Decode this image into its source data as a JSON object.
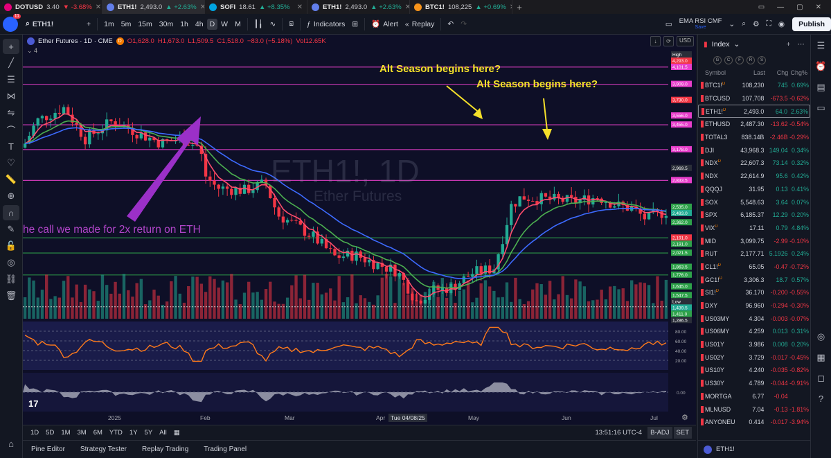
{
  "browser_tabs": [
    {
      "name": "DOTUSD",
      "price": "3.40",
      "change": "▼ -3.68%",
      "dir": "neg",
      "color": "#e6007a"
    },
    {
      "name": "ETH1!",
      "price": "2,493.0",
      "change": "▲ +2.63%",
      "dir": "pos",
      "color": "#627eea",
      "active": true
    },
    {
      "name": "SOFI",
      "price": "18.61",
      "change": "▲ +8.35%",
      "dir": "pos",
      "color": "#00a3e0"
    },
    {
      "name": "ETH1!",
      "price": "2,493.0",
      "change": "▲ +2.63%",
      "dir": "pos",
      "color": "#627eea"
    },
    {
      "name": "BTC1!",
      "price": "108,225",
      "change": "▲ +0.69%",
      "dir": "pos",
      "color": "#f7931a"
    }
  ],
  "toolbar": {
    "avatar_badge": "11",
    "symbol": "ETH1!",
    "timeframes": [
      "1m",
      "5m",
      "15m",
      "30m",
      "1h",
      "4h",
      "D",
      "W",
      "M"
    ],
    "active_timeframe": "D",
    "indicators_label": "Indicators",
    "alert_label": "Alert",
    "replay_label": "Replay",
    "layout_name": "EMA RSI CMF",
    "layout_sub": "Save",
    "publish_label": "Publish"
  },
  "chart": {
    "title": "Ether Futures · 1D · CME",
    "ohlc": {
      "o": "O1,628.0",
      "h": "H1,673.0",
      "l": "L1,509.5",
      "c": "C1,518.0",
      "chg": "−83.0 (−5.18%)",
      "vol": "Vol12.65K"
    },
    "sub_count": "4",
    "currency": "USD",
    "watermark_symbol": "ETH1!, 1D",
    "watermark_name": "Ether Futures",
    "annotation_1": "Alt Season begins here?",
    "annotation_2": "Alt Season begins here?",
    "annotation_3": "he call we made for 2x return on ETH",
    "price_labels": [
      "High",
      "4,293.0",
      "4,101.5",
      "3,909.0",
      "3,730.0",
      "3,556.0",
      "3,455.0",
      "3,178.0",
      "2,969.5",
      "2,833.5",
      "2,535.0",
      "2,493.0",
      "2,362.0",
      "2,191.0",
      "2,191.0",
      "2,021.5",
      "1,863.5",
      "1,776.0",
      "1,645.0",
      "1,547.5",
      "Low",
      "1,439.5",
      "1,411.0",
      "1,286.5"
    ],
    "rsi_labels": [
      "80.00",
      "60.00",
      "40.00",
      "20.00"
    ],
    "cmf_label": "0.00",
    "x_labels": [
      "2025",
      "Feb",
      "Mar",
      "Apr",
      "May",
      "Jun",
      "Jul"
    ],
    "x_highlight": "Tue 04/08/25",
    "tv_logo": "17"
  },
  "chart_data": {
    "type": "candlestick",
    "title": "Ether Futures · 1D · CME",
    "x_range": [
      "2024-12",
      "2025-07"
    ],
    "y_range": [
      1286.5,
      4293.0
    ],
    "horizontal_levels": [
      4101.5,
      3909.0,
      3455.0,
      3178.0,
      2833.5,
      2191.0,
      2021.5,
      1776.0
    ],
    "overlays": [
      "EMA fast (red)",
      "EMA mid (green)",
      "EMA slow (blue)"
    ],
    "panes": [
      "volume",
      "RSI",
      "CMF"
    ]
  },
  "range_bar": {
    "ranges": [
      "1D",
      "5D",
      "1M",
      "3M",
      "6M",
      "YTD",
      "1Y",
      "5Y",
      "All"
    ],
    "clock": "13:51:16 UTC-4",
    "badj": "B-ADJ",
    "set": "SET"
  },
  "panels": [
    "Pine Editor",
    "Strategy Tester",
    "Replay Trading",
    "Trading Panel"
  ],
  "watchlist": {
    "title": "Index",
    "filters": [
      "G",
      "C",
      "F",
      "R",
      "S"
    ],
    "cols": [
      "Symbol",
      "Last",
      "Chg",
      "Chg%"
    ],
    "rows": [
      {
        "sym": "BTC1!",
        "d": true,
        "last": "108,230",
        "chg": "745",
        "pct": "0.69%",
        "dir": "pos",
        "flag": true
      },
      {
        "sym": "BTCUSD",
        "last": "107,708",
        "chg": "-673.5",
        "pct": "-0.62%",
        "dir": "neg",
        "flag": true
      },
      {
        "sym": "ETH1!",
        "d": true,
        "last": "2,493.0",
        "chg": "64.0",
        "pct": "2.63%",
        "dir": "pos",
        "flag": true,
        "sel": true
      },
      {
        "sym": "ETHUSD",
        "last": "2,487.30",
        "chg": "-13.62",
        "pct": "-0.54%",
        "dir": "neg",
        "flag": true
      },
      {
        "sym": "TOTAL3",
        "last": "838.14B",
        "chg": "-2.46B",
        "pct": "-0.29%",
        "dir": "neg",
        "flag": true
      },
      {
        "sym": "DJI",
        "last": "43,968.3",
        "chg": "149.04",
        "pct": "0.34%",
        "dir": "pos",
        "flag": true
      },
      {
        "sym": "NDX",
        "d": true,
        "last": "22,607.3",
        "chg": "73.14",
        "pct": "0.32%",
        "dir": "pos",
        "flag": true
      },
      {
        "sym": "NDX",
        "last": "22,614.9",
        "chg": "95.6",
        "pct": "0.42%",
        "dir": "pos",
        "flag": true
      },
      {
        "sym": "QQQJ",
        "last": "31.95",
        "chg": "0.13",
        "pct": "0.41%",
        "dir": "pos",
        "flag": true
      },
      {
        "sym": "SOX",
        "last": "5,548.63",
        "chg": "3.64",
        "pct": "0.07%",
        "dir": "pos",
        "flag": true
      },
      {
        "sym": "SPX",
        "last": "6,185.37",
        "chg": "12.29",
        "pct": "0.20%",
        "dir": "pos",
        "flag": true
      },
      {
        "sym": "VIX",
        "d": true,
        "last": "17.11",
        "chg": "0.79",
        "pct": "4.84%",
        "dir": "pos",
        "flag": true
      },
      {
        "sym": "MID",
        "last": "3,099.75",
        "chg": "-2.99",
        "pct": "-0.10%",
        "dir": "neg",
        "flag": true
      },
      {
        "sym": "RUT",
        "last": "2,177.71",
        "chg": "5.1926",
        "pct": "0.24%",
        "dir": "pos",
        "flag": true
      },
      {
        "sym": "CL1!",
        "d": true,
        "last": "65.05",
        "chg": "-0.47",
        "pct": "-0.72%",
        "dir": "neg",
        "flag": true
      },
      {
        "sym": "GC1!",
        "d": true,
        "last": "3,306.3",
        "chg": "18.7",
        "pct": "0.57%",
        "dir": "pos",
        "flag": true
      },
      {
        "sym": "SI1!",
        "d": true,
        "last": "36.170",
        "chg": "-0.200",
        "pct": "-0.55%",
        "dir": "neg",
        "flag": true
      },
      {
        "sym": "DXY",
        "last": "96.960",
        "chg": "-0.294",
        "pct": "-0.30%",
        "dir": "neg",
        "flag": true
      },
      {
        "sym": "US03MY",
        "last": "4.304",
        "chg": "-0.003",
        "pct": "-0.07%",
        "dir": "neg",
        "flag": true
      },
      {
        "sym": "US06MY",
        "last": "4.259",
        "chg": "0.013",
        "pct": "0.31%",
        "dir": "pos",
        "flag": true
      },
      {
        "sym": "US01Y",
        "last": "3.986",
        "chg": "0.008",
        "pct": "0.20%",
        "dir": "pos",
        "flag": true
      },
      {
        "sym": "US02Y",
        "last": "3.729",
        "chg": "-0.017",
        "pct": "-0.45%",
        "dir": "neg",
        "flag": true
      },
      {
        "sym": "US10Y",
        "last": "4.240",
        "chg": "-0.035",
        "pct": "-0.82%",
        "dir": "neg",
        "flag": true
      },
      {
        "sym": "US30Y",
        "last": "4.789",
        "chg": "-0.044",
        "pct": "-0.91%",
        "dir": "neg",
        "flag": true
      },
      {
        "sym": "MORTGA",
        "last": "6.77",
        "chg": "-0.04",
        "pct": "",
        "dir": "neg",
        "flag": true
      },
      {
        "sym": "MLNUSD",
        "last": "7.04",
        "chg": "-0.13",
        "pct": "-1.81%",
        "dir": "neg",
        "flag": true
      },
      {
        "sym": "ANYONEU",
        "last": "0.414",
        "chg": "-0.017",
        "pct": "-3.94%",
        "dir": "neg",
        "flag": true
      }
    ],
    "footer_symbol": "ETH1!"
  },
  "colors": {
    "background": "#0e0f27",
    "up": "#22ab94",
    "down": "#f23645",
    "annotation_yellow": "#f5e02a",
    "annotation_purple": "#b145c9",
    "magenta_level": "#e83ecb",
    "green_level": "#2ea24a"
  }
}
